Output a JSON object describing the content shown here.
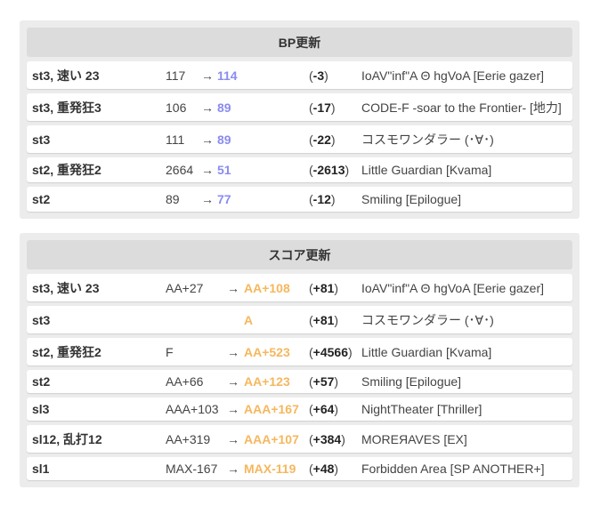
{
  "colors": {
    "bp_new": "#8a8cf0",
    "score_new": "#f5b75e"
  },
  "bp_section": {
    "title": "BP更新",
    "rows": [
      {
        "tag": "st3, 速い 23",
        "old": "117",
        "arrow": "→",
        "new": "114",
        "diff_open": "(",
        "diff_value": "-3",
        "diff_close": ")",
        "title": "IoAV\"inf\"A Θ hgVoA [Eerie gazer]"
      },
      {
        "tag": "st3, 重発狂3",
        "old": "106",
        "arrow": "→",
        "new": "89",
        "diff_open": "(",
        "diff_value": "-17",
        "diff_close": ")",
        "title": "CODE-F -soar to the Frontier- [地力]"
      },
      {
        "tag": "st3",
        "old": "111",
        "arrow": "→",
        "new": "89",
        "diff_open": "(",
        "diff_value": "-22",
        "diff_close": ")",
        "title": "コスモワンダラー (･∀･)"
      },
      {
        "tag": "st2, 重発狂2",
        "old": "2664",
        "arrow": "→",
        "new": "51",
        "diff_open": "(",
        "diff_value": "-2613",
        "diff_close": ")",
        "title": "Little Guardian [Kvama]"
      },
      {
        "tag": "st2",
        "old": "89",
        "arrow": "→",
        "new": "77",
        "diff_open": "(",
        "diff_value": "-12",
        "diff_close": ")",
        "title": "Smiling [Epilogue]"
      }
    ]
  },
  "score_section": {
    "title": "スコア更新",
    "rows": [
      {
        "tag": "st3, 速い 23",
        "old": "AA+27",
        "arrow": "→",
        "new": "AA+108",
        "diff_open": "(",
        "diff_value": "+81",
        "diff_close": ")",
        "title": "IoAV\"inf\"A Θ hgVoA [Eerie gazer]"
      },
      {
        "tag": "st3",
        "old": "",
        "arrow": "",
        "new": "A",
        "diff_open": "(",
        "diff_value": "+81",
        "diff_close": ")",
        "title": "コスモワンダラー (･∀･)"
      },
      {
        "tag": "st2, 重発狂2",
        "old": "F",
        "arrow": "→",
        "new": "AA+523",
        "diff_open": "(",
        "diff_value": "+4566",
        "diff_close": ")",
        "title": "Little Guardian [Kvama]"
      },
      {
        "tag": "st2",
        "old": "AA+66",
        "arrow": "→",
        "new": "AA+123",
        "diff_open": "(",
        "diff_value": "+57",
        "diff_close": ")",
        "title": "Smiling [Epilogue]"
      },
      {
        "tag": "sl3",
        "old": "AAA+103",
        "arrow": "→",
        "new": "AAA+167",
        "diff_open": "(",
        "diff_value": "+64",
        "diff_close": ")",
        "title": "NightTheater [Thriller]"
      },
      {
        "tag": "sl12, 乱打12",
        "old": "AA+319",
        "arrow": "→",
        "new": "AAA+107",
        "diff_open": "(",
        "diff_value": "+384",
        "diff_close": ")",
        "title": "MOREЯAVES [EX]"
      },
      {
        "tag": "sl1",
        "old": "MAX-167",
        "arrow": "→",
        "new": "MAX-119",
        "diff_open": "(",
        "diff_value": "+48",
        "diff_close": ")",
        "title": "Forbidden Area [SP ANOTHER+]"
      }
    ]
  }
}
